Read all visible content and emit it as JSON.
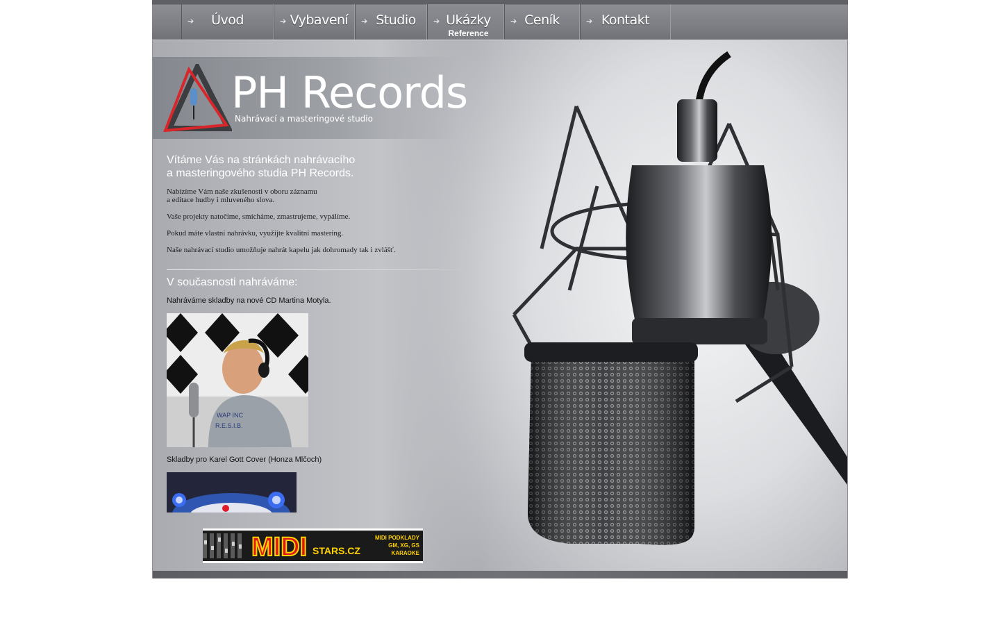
{
  "nav": {
    "items": [
      {
        "label": "Úvod",
        "sub": ""
      },
      {
        "label": "Vybavení",
        "sub": ""
      },
      {
        "label": "Studio",
        "sub": ""
      },
      {
        "label": "Ukázky",
        "sub": "Reference"
      },
      {
        "label": "Ceník",
        "sub": ""
      },
      {
        "label": "Kontakt",
        "sub": ""
      }
    ],
    "arrow_icon": "arrow-right-icon"
  },
  "brand": {
    "title": "PH Records",
    "subtitle": "Nahrávací a masteringové studio"
  },
  "intro": {
    "welcome_line1": "Vítáme Vás na stránkách nahrávacího",
    "welcome_line2": "a masteringového studia PH Records.",
    "p1_line1": "Nabízíme Vám naše zkušenosti v oboru záznamu",
    "p1_line2": "a editace hudby i mluveného slova.",
    "p2": "Vaše projekty natočíme, smícháme, zmastrujeme, vypálíme.",
    "p3": "Pokud máte vlastní nahrávku, využijte kvalitní mastering.",
    "p4": "Naše nahrávací studio umožňuje nahrát kapelu jak dohromady tak i zvlášť."
  },
  "current": {
    "heading": "V současnosti nahráváme:",
    "caption1": "Nahráváme skladby na nové CD Martina Motyla.",
    "caption2": "Skladby pro Karel Gott Cover (Honza Mlčoch)",
    "shirt_line1": "WAP INC",
    "shirt_line2": "R.E.S.I.B."
  },
  "banner": {
    "brand": "MIDI",
    "brand_suffix": "STARS.CZ",
    "tag_line1": "MIDI PODKLADY",
    "tag_line2": "GM, XG, GS",
    "tag_line3": "KARAOKE"
  },
  "colors": {
    "nav_bg": "#7b7d83",
    "logo_red": "#d8262a",
    "banner_yellow": "#ffd200",
    "banner_red": "#e0141b"
  }
}
